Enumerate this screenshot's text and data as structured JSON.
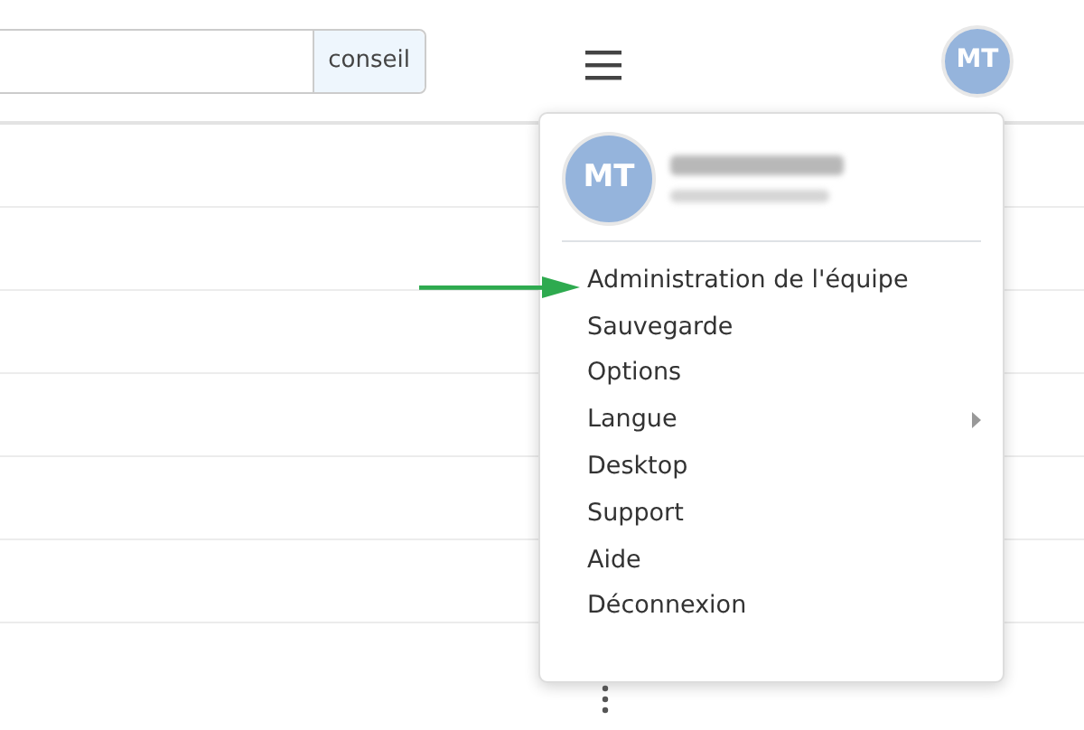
{
  "search": {
    "button": "conseil"
  },
  "top_avatar": {
    "initials": "MT"
  },
  "menu": {
    "avatar_initials": "MT",
    "items": [
      {
        "label": "Administration de l'équipe",
        "kind": "link",
        "pointed": true
      },
      {
        "label": "Sauvegarde",
        "kind": "link",
        "pointed": false
      },
      {
        "label": "Options",
        "kind": "link",
        "pointed": false
      },
      {
        "label": "Langue",
        "kind": "submenu",
        "pointed": false
      },
      {
        "label": "Desktop",
        "kind": "link",
        "pointed": false
      },
      {
        "label": "Support",
        "kind": "link",
        "pointed": false
      },
      {
        "label": "Aide",
        "kind": "link",
        "pointed": false
      },
      {
        "label": "Déconnexion",
        "kind": "link",
        "pointed": false
      }
    ]
  }
}
